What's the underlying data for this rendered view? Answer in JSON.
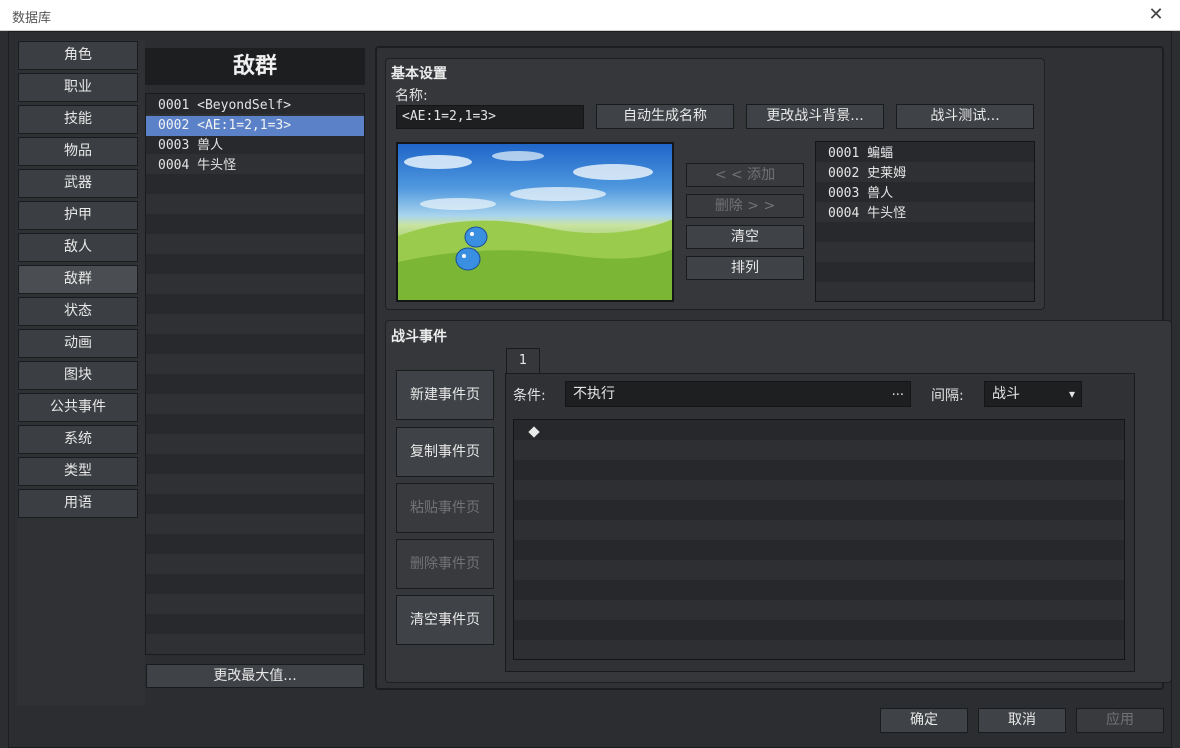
{
  "window": {
    "title": "数据库",
    "close_glyph": "✕"
  },
  "categories": [
    "角色",
    "职业",
    "技能",
    "物品",
    "武器",
    "护甲",
    "敌人",
    "敌群",
    "状态",
    "动画",
    "图块",
    "公共事件",
    "系统",
    "类型",
    "用语"
  ],
  "selected_category": "敌群",
  "list": {
    "header": "敌群",
    "items": [
      "0001 <BeyondSelf>",
      "0002 <AE:1=2,1=3>",
      "0003 兽人",
      "0004 牛头怪"
    ],
    "selected_index": 1,
    "change_max_label": "更改最大值..."
  },
  "basic": {
    "title": "基本设置",
    "name_label": "名称:",
    "name_value": "<AE:1=2,1=3>",
    "auto_name_label": "自动生成名称",
    "change_bg_label": "更改战斗背景...",
    "battle_test_label": "战斗测试...",
    "add_label": "< < 添加",
    "remove_label": "删除 > >",
    "clear_label": "清空",
    "arrange_label": "排列",
    "members": [
      "0001 蝙蝠",
      "0002 史莱姆",
      "0003 兽人",
      "0004 牛头怪"
    ]
  },
  "events": {
    "title": "战斗事件",
    "new_page": "新建事件页",
    "copy_page": "复制事件页",
    "paste_page": "粘贴事件页",
    "delete_page": "删除事件页",
    "clear_page": "清空事件页",
    "tab_label": "1",
    "condition_label": "条件:",
    "condition_value": "不执行",
    "condition_ellipsis": "...",
    "span_label": "间隔:",
    "span_value": "战斗",
    "span_arrow": "▾"
  },
  "footer": {
    "ok": "确定",
    "cancel": "取消",
    "apply": "应用"
  },
  "colors": {
    "selection": "#5b82c8",
    "panel": "#2f3134",
    "window": "#2b2d30"
  }
}
